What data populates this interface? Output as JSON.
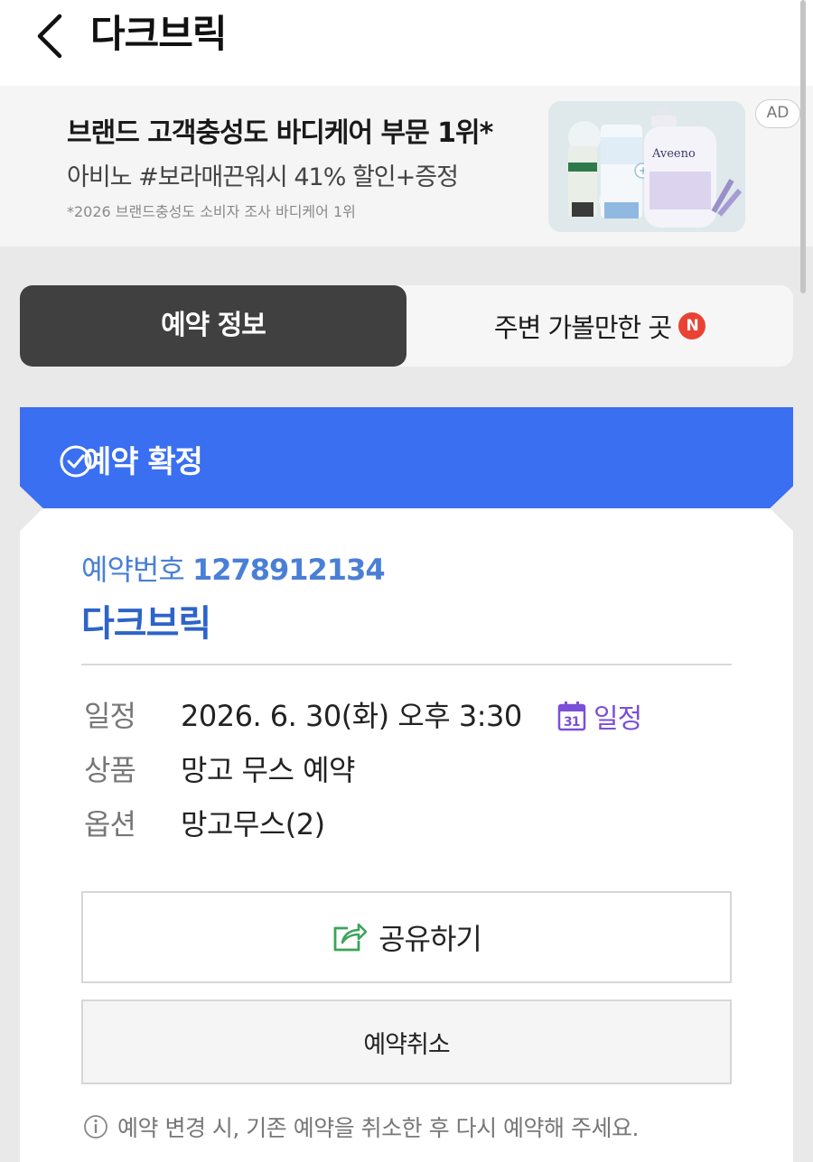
{
  "header": {
    "title": "다크브릭",
    "back_icon": "chevron-left-icon"
  },
  "ad": {
    "title": "브랜드 고객충성도 바디케어 부문 1위*",
    "subtitle": "아비노 #보라매끈워시 41% 할인+증정",
    "note": "*2026 브랜드충성도 소비자 조사 바디케어 1위",
    "badge": "AD",
    "product_brand": "Aveeno"
  },
  "tabs": {
    "active_label": "예약 정보",
    "inactive_label": "주변 가볼만한 곳",
    "new_badge": "N"
  },
  "status": {
    "label": "예약 확정",
    "icon": "check-circle-icon",
    "color": "#3b6ff1"
  },
  "reservation": {
    "number_label": "예약번호",
    "number": "1278912134",
    "store_name": "다크브릭",
    "details": [
      {
        "label": "일정",
        "value": "2026. 6. 30(화) 오후 3:30"
      },
      {
        "label": "상품",
        "value": "망고 무스 예약"
      },
      {
        "label": "옵션",
        "value": "망고무스(2)"
      }
    ],
    "calendar_link_label": "일정",
    "calendar_icon_day": "31"
  },
  "actions": {
    "share_label": "공유하기",
    "cancel_label": "예약취소"
  },
  "notice": {
    "text": "예약 변경 시, 기존 예약을 취소한 후 다시 예약해 주세요.",
    "icon": "info-icon"
  }
}
